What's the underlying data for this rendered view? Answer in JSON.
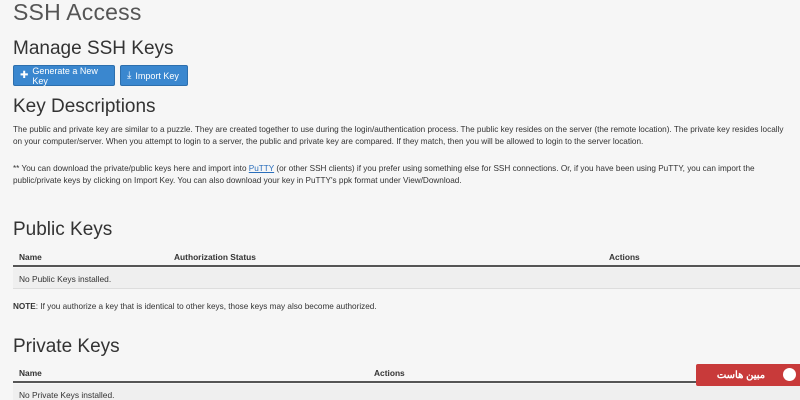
{
  "page": {
    "title": "SSH Access"
  },
  "manage": {
    "heading": "Manage SSH Keys",
    "generate_label": "Generate a New Key",
    "import_label": "Import Key",
    "generate_icon": "plus-icon",
    "import_icon": "import-icon"
  },
  "descriptions": {
    "heading": "Key Descriptions",
    "paragraph1": "The public and private key are similar to a puzzle. They are created together to use during the login/authentication process. The public key resides on the server (the remote location). The private key resides locally on your computer/server. When you attempt to login to a server, the public and private key are compared. If they match, then you will be allowed to login to the server location.",
    "paragraph2_before": "** You can download the private/public keys here and import into ",
    "paragraph2_link": "PuTTY",
    "paragraph2_after": " (or other SSH clients) if you prefer using something else for SSH connections. Or, if you have been using PuTTY, you can import the public/private keys by clicking on Import Key. You can also download your key in PuTTY's ppk format under View/Download."
  },
  "public_keys": {
    "heading": "Public Keys",
    "columns": {
      "name": "Name",
      "status": "Authorization Status",
      "actions": "Actions"
    },
    "empty_text": "No Public Keys installed."
  },
  "note": {
    "label": "NOTE",
    "text": ": If you authorize a key that is identical to other keys, those keys may also become authorized."
  },
  "private_keys": {
    "heading": "Private Keys",
    "columns": {
      "name": "Name",
      "actions": "Actions"
    },
    "empty_text": "No Private Keys installed."
  },
  "watermark": {
    "text": "مبین هاست"
  },
  "colors": {
    "button_bg": "#3a87cf",
    "link": "#2a6ebb",
    "watermark_bg": "#c83a3a"
  }
}
